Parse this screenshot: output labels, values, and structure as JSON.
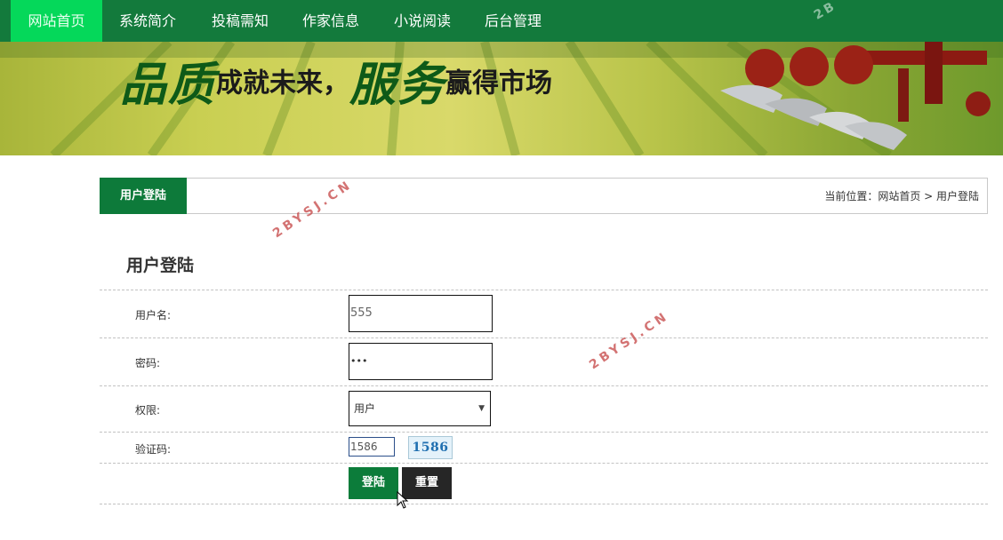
{
  "nav": {
    "items": [
      {
        "label": "网站首页"
      },
      {
        "label": "系统简介"
      },
      {
        "label": "投稿需知"
      },
      {
        "label": "作家信息"
      },
      {
        "label": "小说阅读"
      },
      {
        "label": "后台管理"
      }
    ]
  },
  "banner": {
    "text_1": "品质",
    "text_2": "成就未来，",
    "text_3": "服务",
    "text_4": "赢得市场"
  },
  "titlebar": {
    "tab_label": "用户登陆",
    "breadcrumb": "当前位置：网站首页 > 用户登陆"
  },
  "login": {
    "heading": "用户登陆",
    "username_label": "用户名:",
    "username_value": "555",
    "password_label": "密码:",
    "password_value": "•••",
    "role_label": "权限:",
    "role_selected": "用户",
    "captcha_label": "验证码:",
    "captcha_value": "1586",
    "captcha_image_text": "1586",
    "login_button": "登陆",
    "reset_button": "重置"
  },
  "watermark": {
    "text": "2BYSJ.CN",
    "corner": "2B"
  },
  "colors": {
    "nav_bg": "#137a3c",
    "nav_active": "#05d85a",
    "accent": "#0d7a3a",
    "reset_button": "#262626"
  }
}
